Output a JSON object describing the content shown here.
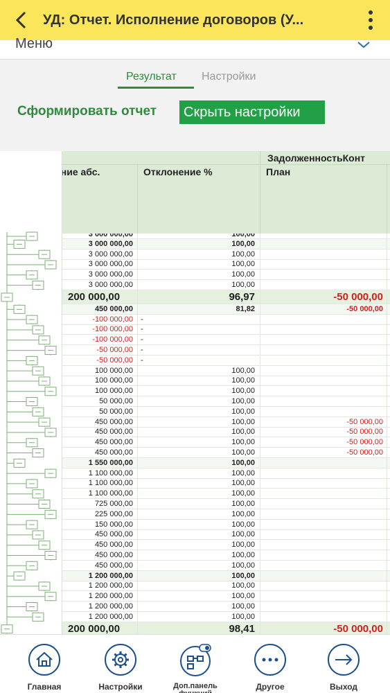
{
  "window": {
    "title": "УД: Отчет. Исполнение договоров (У..."
  },
  "menu": {
    "label": "Меню"
  },
  "tabs": [
    {
      "label": "Результат",
      "active": true
    },
    {
      "label": "Настройки",
      "active": false
    }
  ],
  "actions": {
    "generate_report": "Сформировать отчет",
    "hide_settings": "Скрыть настройки"
  },
  "table": {
    "group_header": "ЗадолженностьКонт",
    "columns": [
      "ение абс.",
      "Отклонение %",
      "План"
    ],
    "partial_top": {
      "v1": "3 000 000,00",
      "v2": "100,00"
    },
    "rows": [
      {
        "v1": "3 000 000,00",
        "v2": "100,00",
        "v3": "",
        "style": "bold"
      },
      {
        "v1": "3 000 000,00",
        "v2": "100,00",
        "v3": "",
        "style": ""
      },
      {
        "v1": "3 000 000,00",
        "v2": "100,00",
        "v3": "",
        "style": ""
      },
      {
        "v1": "3 000 000,00",
        "v2": "100,00",
        "v3": "",
        "style": ""
      },
      {
        "v1": "3 000 000,00",
        "v2": "100,00",
        "v3": "",
        "style": ""
      },
      {
        "v1": "200 000,00",
        "v2": "96,97",
        "v3": "-50 000,00",
        "style": "big"
      },
      {
        "v1": "450 000,00",
        "v2": "81,82",
        "v3": "-50 000,00",
        "style": "bold"
      },
      {
        "v1": "-100 000,00",
        "v2": "-",
        "v3": "",
        "style": ""
      },
      {
        "v1": "-100 000,00",
        "v2": "-",
        "v3": "",
        "style": ""
      },
      {
        "v1": "-100 000,00",
        "v2": "-",
        "v3": "",
        "style": ""
      },
      {
        "v1": "-50 000,00",
        "v2": "-",
        "v3": "",
        "style": ""
      },
      {
        "v1": "-50 000,00",
        "v2": "-",
        "v3": "",
        "style": ""
      },
      {
        "v1": "100 000,00",
        "v2": "100,00",
        "v3": "",
        "style": ""
      },
      {
        "v1": "100 000,00",
        "v2": "100,00",
        "v3": "",
        "style": ""
      },
      {
        "v1": "100 000,00",
        "v2": "100,00",
        "v3": "",
        "style": ""
      },
      {
        "v1": "50 000,00",
        "v2": "100,00",
        "v3": "",
        "style": ""
      },
      {
        "v1": "50 000,00",
        "v2": "100,00",
        "v3": "",
        "style": ""
      },
      {
        "v1": "450 000,00",
        "v2": "100,00",
        "v3": "-50 000,00",
        "style": ""
      },
      {
        "v1": "450 000,00",
        "v2": "100,00",
        "v3": "-50 000,00",
        "style": ""
      },
      {
        "v1": "450 000,00",
        "v2": "100,00",
        "v3": "-50 000,00",
        "style": ""
      },
      {
        "v1": "450 000,00",
        "v2": "100,00",
        "v3": "-50 000,00",
        "style": ""
      },
      {
        "v1": "1 550 000,00",
        "v2": "100,00",
        "v3": "",
        "style": "bold"
      },
      {
        "v1": "1 100 000,00",
        "v2": "100,00",
        "v3": "",
        "style": ""
      },
      {
        "v1": "1 100 000,00",
        "v2": "100,00",
        "v3": "",
        "style": ""
      },
      {
        "v1": "1 100 000,00",
        "v2": "100,00",
        "v3": "",
        "style": ""
      },
      {
        "v1": "725 000,00",
        "v2": "100,00",
        "v3": "",
        "style": ""
      },
      {
        "v1": "225 000,00",
        "v2": "100,00",
        "v3": "",
        "style": ""
      },
      {
        "v1": "150 000,00",
        "v2": "100,00",
        "v3": "",
        "style": ""
      },
      {
        "v1": "450 000,00",
        "v2": "100,00",
        "v3": "",
        "style": ""
      },
      {
        "v1": "450 000,00",
        "v2": "100,00",
        "v3": "",
        "style": ""
      },
      {
        "v1": "450 000,00",
        "v2": "100,00",
        "v3": "",
        "style": ""
      },
      {
        "v1": "450 000,00",
        "v2": "100,00",
        "v3": "",
        "style": ""
      },
      {
        "v1": "1 200 000,00",
        "v2": "100,00",
        "v3": "",
        "style": "bold"
      },
      {
        "v1": "1 200 000,00",
        "v2": "100,00",
        "v3": "",
        "style": ""
      },
      {
        "v1": "1 200 000,00",
        "v2": "100,00",
        "v3": "",
        "style": ""
      },
      {
        "v1": "1 200 000,00",
        "v2": "100,00",
        "v3": "",
        "style": ""
      },
      {
        "v1": "1 200 000,00",
        "v2": "100,00",
        "v3": "",
        "style": ""
      },
      {
        "v1": "200 000,00",
        "v2": "98,41",
        "v3": "-50 000,00",
        "style": "big"
      }
    ]
  },
  "bottom_nav": [
    {
      "label": "Главная",
      "icon": "home-icon"
    },
    {
      "label": "Настройки",
      "icon": "gear-icon"
    },
    {
      "label": "Доп.панель функций",
      "icon": "function-panel-icon"
    },
    {
      "label": "Другое",
      "icon": "more-icon"
    },
    {
      "label": "Выход",
      "icon": "exit-icon"
    }
  ],
  "colors": {
    "titlebar": "#fbe55a",
    "accent": "#2f8a3d",
    "button": "#21a046",
    "header": "#dcebd6",
    "negative": "#d02020"
  }
}
